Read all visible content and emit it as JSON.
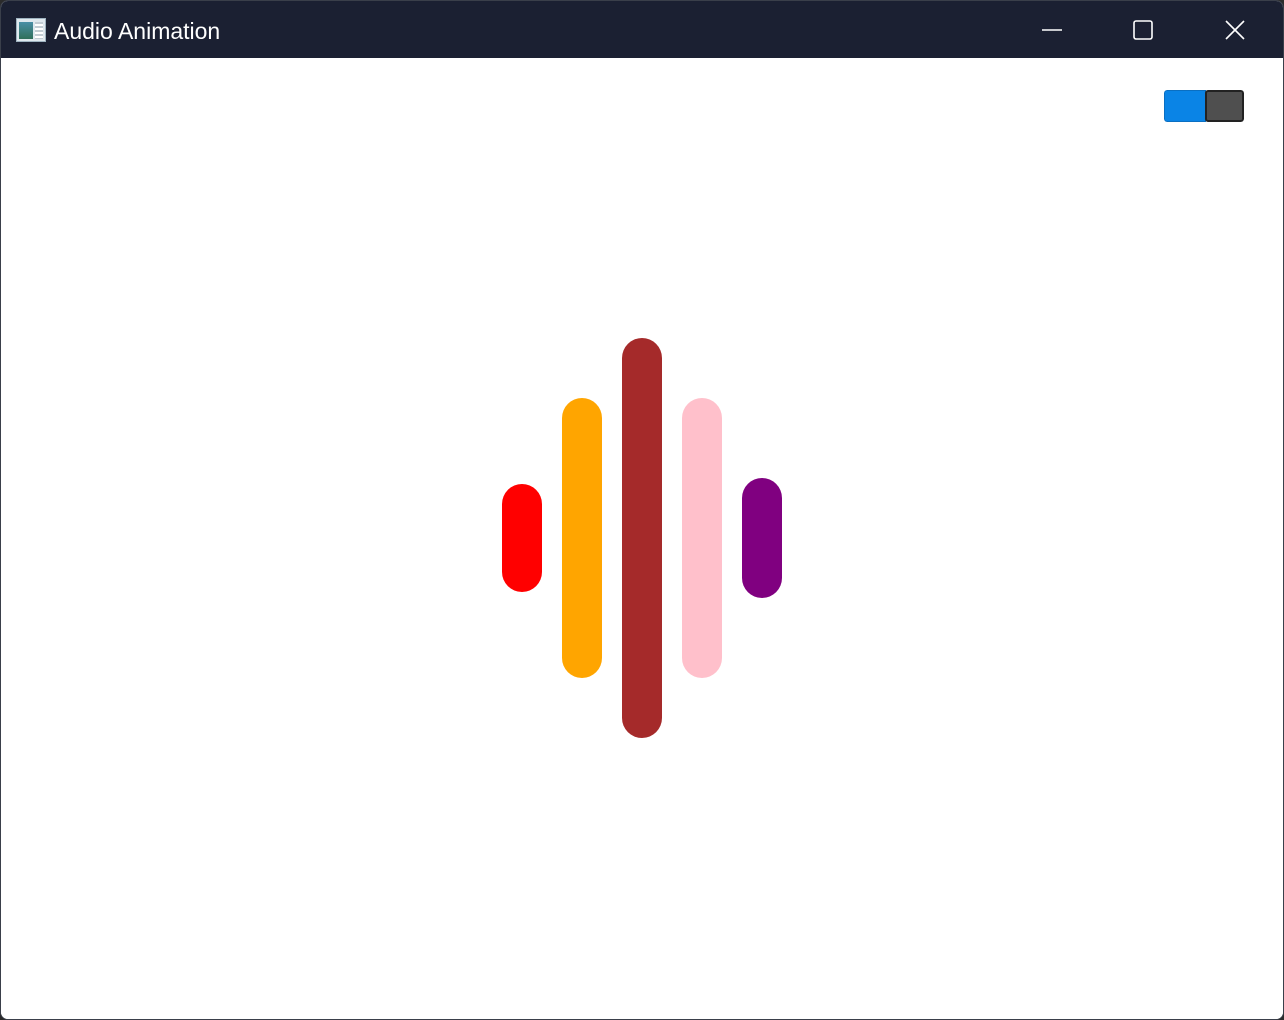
{
  "window": {
    "title": "Audio Animation",
    "app_icon": "app-window-icon",
    "controls": {
      "minimize_icon": "minimize-icon",
      "maximize_icon": "maximize-icon",
      "close_icon": "close-icon"
    }
  },
  "toggle": {
    "state": "on",
    "on_color": "#0a84e6",
    "knob_color": "#4f4f4f"
  },
  "visualizer": {
    "level_scale_max": 1.0,
    "bars": [
      {
        "color": "#ff0000",
        "level": 0.27
      },
      {
        "color": "#ffa500",
        "level": 0.7
      },
      {
        "color": "#a52a2a",
        "level": 1.0
      },
      {
        "color": "#ffc0cb",
        "level": 0.7
      },
      {
        "color": "#800080",
        "level": 0.3
      }
    ]
  }
}
